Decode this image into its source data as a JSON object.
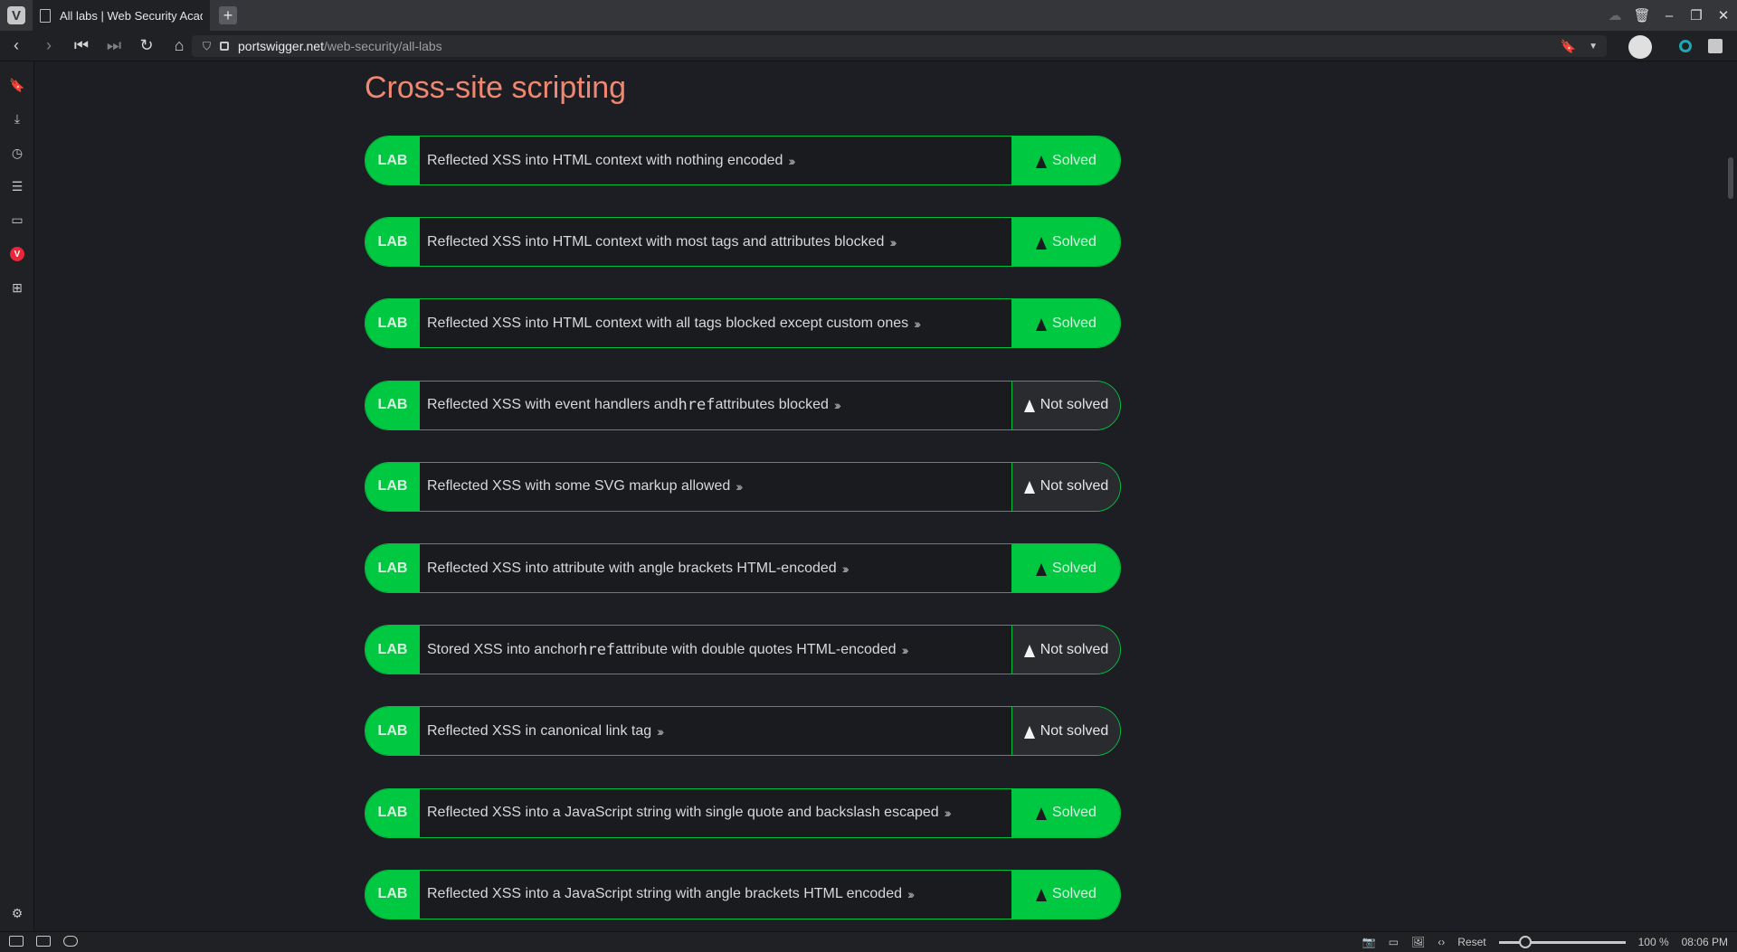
{
  "tab": {
    "title": "All labs | Web Security Academy"
  },
  "address": {
    "domain": "portswigger.net",
    "path": "/web-security/all-labs"
  },
  "section": {
    "title": "Cross-site scripting"
  },
  "labs": [
    {
      "tag": "LAB",
      "pre": "Reflected XSS into HTML context with nothing encoded",
      "code": "",
      "post": "",
      "status": "Solved",
      "solved": true
    },
    {
      "tag": "LAB",
      "pre": "Reflected XSS into HTML context with most tags and attributes blocked",
      "code": "",
      "post": "",
      "status": "Solved",
      "solved": true
    },
    {
      "tag": "LAB",
      "pre": "Reflected XSS into HTML context with all tags blocked except custom ones",
      "code": "",
      "post": "",
      "status": "Solved",
      "solved": true
    },
    {
      "tag": "LAB",
      "pre": "Reflected XSS with event handlers and ",
      "code": "href",
      "post": " attributes blocked",
      "status": "Not solved",
      "solved": false
    },
    {
      "tag": "LAB",
      "pre": "Reflected XSS with some SVG markup allowed",
      "code": "",
      "post": "",
      "status": "Not solved",
      "solved": false
    },
    {
      "tag": "LAB",
      "pre": "Reflected XSS into attribute with angle brackets HTML-encoded",
      "code": "",
      "post": "",
      "status": "Solved",
      "solved": true
    },
    {
      "tag": "LAB",
      "pre": "Stored XSS into anchor ",
      "code": "href",
      "post": " attribute with double quotes HTML-encoded",
      "status": "Not solved",
      "solved": false
    },
    {
      "tag": "LAB",
      "pre": "Reflected XSS in canonical link tag",
      "code": "",
      "post": "",
      "status": "Not solved",
      "solved": false
    },
    {
      "tag": "LAB",
      "pre": "Reflected XSS into a JavaScript string with single quote and backslash escaped",
      "code": "",
      "post": "",
      "status": "Solved",
      "solved": true
    },
    {
      "tag": "LAB",
      "pre": "Reflected XSS into a JavaScript string with angle brackets HTML encoded",
      "code": "",
      "post": "",
      "status": "Solved",
      "solved": true
    }
  ],
  "statusbar": {
    "reset": "Reset",
    "zoom": "100 %",
    "time": "08:06 PM"
  },
  "colors": {
    "accent": "#00c941",
    "heading": "#f08770"
  }
}
